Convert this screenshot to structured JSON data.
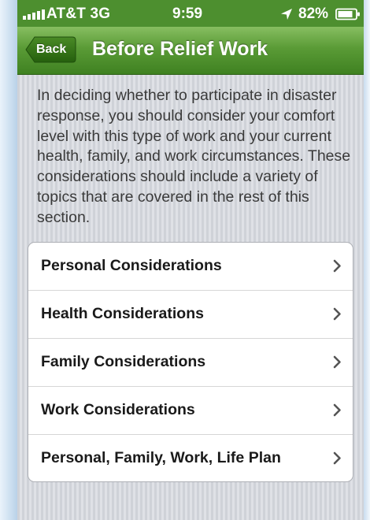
{
  "status_bar": {
    "carrier": "AT&T",
    "network": "3G",
    "time": "9:59",
    "battery": "82%",
    "battery_level": 0.82,
    "icons": [
      "signal-bars-icon",
      "location-arrow-icon",
      "battery-icon"
    ]
  },
  "nav": {
    "back_label": "Back",
    "title": "Before Relief Work"
  },
  "intro": {
    "text": "In deciding whether to participate in disaster response, you should consider your comfort level with this type of work and your current health, family, and work circumstances. These considerations should include a variety of topics that are covered in the rest of this section."
  },
  "menu": {
    "items": [
      {
        "label": "Personal Considerations"
      },
      {
        "label": "Health Considerations"
      },
      {
        "label": "Family Considerations"
      },
      {
        "label": "Work Considerations"
      },
      {
        "label": "Personal, Family, Work, Life Plan"
      }
    ],
    "chevron_icon": "chevron-right-icon"
  },
  "colors": {
    "status_bar": "#4d8f2f",
    "nav_bar_top": "#87be61",
    "nav_bar_bottom": "#3f8121",
    "back_button": "#2f6c14",
    "text": "#3a3a3a",
    "menu_label": "#1a1a1a"
  }
}
